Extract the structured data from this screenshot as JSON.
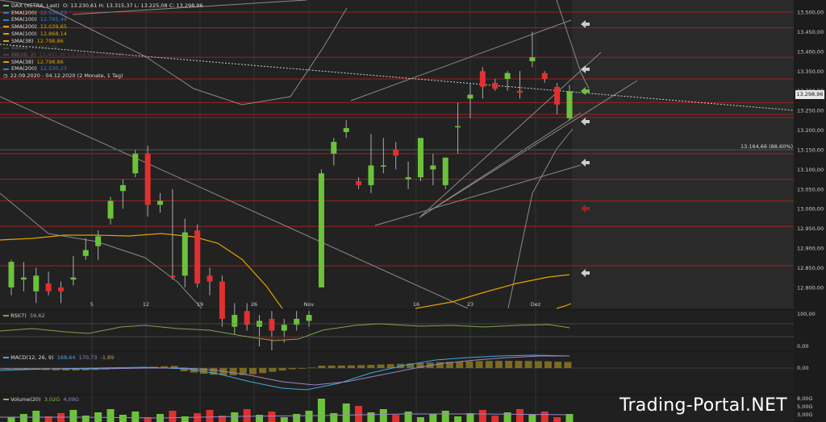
{
  "legend": {
    "instrument": "DAX (XETRA, Last)",
    "ohlc": "O: 13.230,61  H: 13.315,37  L: 13.225,08  C: 13.298,96",
    "items": [
      {
        "label": "EMA(200)",
        "value": "12.530,23",
        "color": "#2f7fd8",
        "dim": false
      },
      {
        "label": "EMA(100)",
        "value": "12.765,44",
        "color": "#2f7fd8",
        "dim": false
      },
      {
        "label": "SMA(200)",
        "value": "12.039,65",
        "color": "#e0a000",
        "dim": false
      },
      {
        "label": "SMA(100)",
        "value": "12.868,14",
        "color": "#e0a000",
        "dim": false
      },
      {
        "label": "SMA(38)",
        "value": "12.798,86",
        "color": "#e0a000",
        "dim": false
      },
      {
        "label": "Bands",
        "value": "12.855,28",
        "color": "#888888",
        "dim": true
      },
      {
        "label": "BB(20, 2)",
        "value": "13.407,30  13.209,61  13.008,94",
        "color": "#888888",
        "dim": true
      },
      {
        "label": "SMA(38)",
        "value": "12.798,86",
        "color": "#e0a000",
        "dim": false
      },
      {
        "label": "EMA(200)",
        "value": "12.530,23",
        "color": "#2f7fd8",
        "dim": false
      }
    ],
    "period": "22.09.2020 - 04.12.2020",
    "period_note": "(2 Monate, 1 Tag)"
  },
  "price_axis": {
    "ticks": [
      "13.500,00",
      "13.450,00",
      "13.400,00",
      "13.350,00",
      "13.300,00",
      "13.250,00",
      "13.200,00",
      "13.150,00",
      "13.100,00",
      "13.050,00",
      "13.000,00",
      "12.950,00",
      "12.900,00",
      "12.850,00",
      "12.800,00"
    ],
    "last_price": "13.298,96",
    "marker_label": "13.164,66 (88,60%)"
  },
  "x_axis": {
    "labels": [
      "5",
      "12",
      "19",
      "26",
      "Nov",
      "16",
      "23",
      "Dez"
    ]
  },
  "rsi": {
    "label": "RSI(7)",
    "value": "59,62",
    "axis": [
      "100,00",
      "0,00"
    ]
  },
  "macd": {
    "label": "MACD(12, 26, 9)",
    "v1": "168,64",
    "v2": "170,73",
    "v3": "-1,89",
    "axis": [
      "0,00"
    ]
  },
  "volume": {
    "label": "Volume(20)",
    "v1": "3,02G",
    "v2": "4,09G",
    "axis": [
      "8,00G",
      "5,00G",
      "3,00G"
    ]
  },
  "watermark": "Trading-Portal.NET",
  "chart_data": {
    "type": "candlestick",
    "x_labels": [
      "5",
      "12",
      "19",
      "26",
      "Nov",
      "16",
      "23",
      "Dez"
    ],
    "y_ticks": [
      13500,
      13450,
      13400,
      13350,
      13300,
      13250,
      13200,
      13150,
      13100,
      13050,
      13000,
      12950,
      12900,
      12850,
      12800
    ],
    "candles": [
      {
        "o": 12800,
        "h": 12870,
        "l": 12780,
        "c": 12865
      },
      {
        "o": 12820,
        "h": 12865,
        "l": 12790,
        "c": 12825
      },
      {
        "o": 12790,
        "h": 12850,
        "l": 12760,
        "c": 12830
      },
      {
        "o": 12810,
        "h": 12840,
        "l": 12780,
        "c": 12790
      },
      {
        "o": 12800,
        "h": 12815,
        "l": 12760,
        "c": 12790
      },
      {
        "o": 12820,
        "h": 12880,
        "l": 12805,
        "c": 12825
      },
      {
        "o": 12880,
        "h": 12925,
        "l": 12870,
        "c": 12895
      },
      {
        "o": 12905,
        "h": 12945,
        "l": 12870,
        "c": 12930
      },
      {
        "o": 12975,
        "h": 13030,
        "l": 12960,
        "c": 13020
      },
      {
        "o": 13045,
        "h": 13075,
        "l": 13000,
        "c": 13060
      },
      {
        "o": 13090,
        "h": 13150,
        "l": 13080,
        "c": 13140
      },
      {
        "o": 13140,
        "h": 13160,
        "l": 12980,
        "c": 13010
      },
      {
        "o": 13010,
        "h": 13040,
        "l": 12990,
        "c": 13020
      },
      {
        "o": 12830,
        "h": 13050,
        "l": 12820,
        "c": 12825
      },
      {
        "o": 12830,
        "h": 12975,
        "l": 12800,
        "c": 12940
      },
      {
        "o": 12945,
        "h": 12960,
        "l": 12800,
        "c": 12810
      },
      {
        "o": 12830,
        "h": 12850,
        "l": 12780,
        "c": 12815
      },
      {
        "o": 12815,
        "h": 12830,
        "l": 12700,
        "c": 12720
      },
      {
        "o": 12700,
        "h": 12760,
        "l": 12680,
        "c": 12730
      },
      {
        "o": 12740,
        "h": 12760,
        "l": 12690,
        "c": 12705
      },
      {
        "o": 12700,
        "h": 12730,
        "l": 12650,
        "c": 12715
      },
      {
        "o": 12720,
        "h": 12740,
        "l": 12640,
        "c": 12690
      },
      {
        "o": 12690,
        "h": 12720,
        "l": 12660,
        "c": 12705
      },
      {
        "o": 12705,
        "h": 12740,
        "l": 12690,
        "c": 12720
      },
      {
        "o": 12715,
        "h": 12740,
        "l": 12700,
        "c": 12730
      },
      {
        "o": 12800,
        "h": 13100,
        "l": 12800,
        "c": 13090
      },
      {
        "o": 13140,
        "h": 13180,
        "l": 13110,
        "c": 13170
      },
      {
        "o": 13195,
        "h": 13225,
        "l": 13180,
        "c": 13205
      },
      {
        "o": 13070,
        "h": 13080,
        "l": 13050,
        "c": 13060
      },
      {
        "o": 13060,
        "h": 13190,
        "l": 13040,
        "c": 13110
      },
      {
        "o": 13110,
        "h": 13180,
        "l": 13090,
        "c": 13110
      },
      {
        "o": 13150,
        "h": 13170,
        "l": 13100,
        "c": 13135
      },
      {
        "o": 13075,
        "h": 13120,
        "l": 13050,
        "c": 13080
      },
      {
        "o": 13080,
        "h": 13170,
        "l": 13070,
        "c": 13180
      },
      {
        "o": 13100,
        "h": 13140,
        "l": 13060,
        "c": 13110
      },
      {
        "o": 13060,
        "h": 13130,
        "l": 13050,
        "c": 13130
      },
      {
        "o": 13210,
        "h": 13270,
        "l": 13140,
        "c": 13210
      },
      {
        "o": 13280,
        "h": 13320,
        "l": 13230,
        "c": 13290
      },
      {
        "o": 13350,
        "h": 13360,
        "l": 13280,
        "c": 13310
      },
      {
        "o": 13320,
        "h": 13330,
        "l": 13300,
        "c": 13305
      },
      {
        "o": 13330,
        "h": 13350,
        "l": 13300,
        "c": 13345
      },
      {
        "o": 13300,
        "h": 13350,
        "l": 13280,
        "c": 13295
      },
      {
        "o": 13375,
        "h": 13450,
        "l": 13360,
        "c": 13385
      },
      {
        "o": 13345,
        "h": 13350,
        "l": 13320,
        "c": 13330
      },
      {
        "o": 13310,
        "h": 13320,
        "l": 13240,
        "c": 13265
      },
      {
        "o": 13230,
        "h": 13315,
        "l": 13225,
        "c": 13299
      }
    ]
  }
}
